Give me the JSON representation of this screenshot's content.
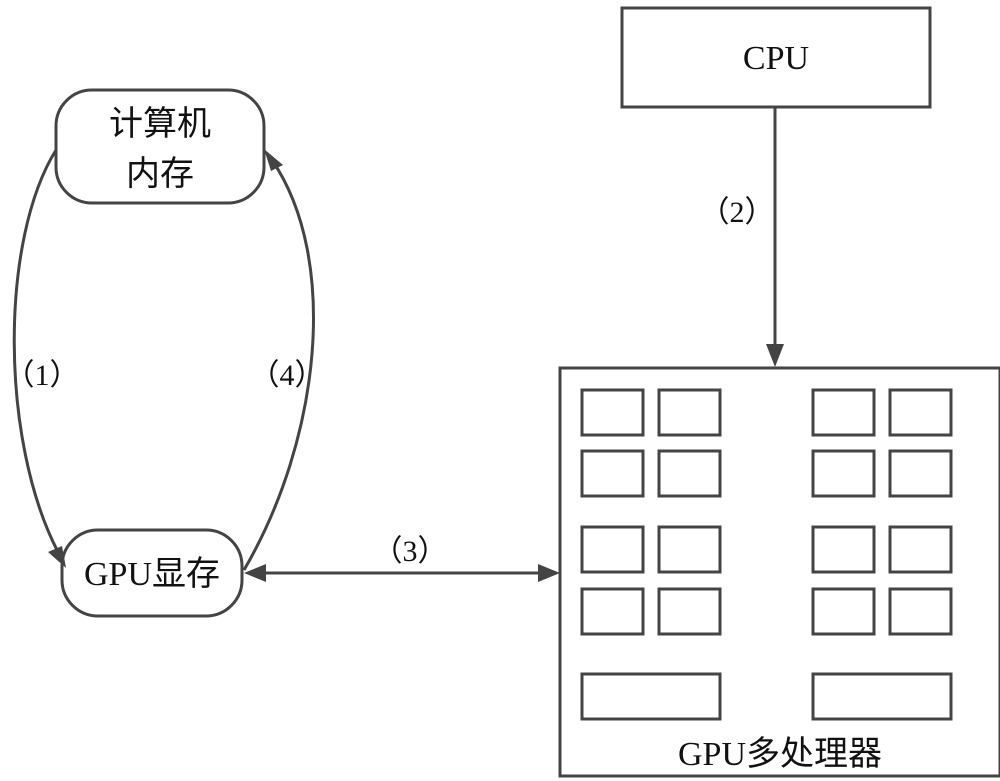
{
  "nodes": {
    "computer_memory": {
      "line1": "计算机",
      "line2": "内存"
    },
    "gpu_memory": {
      "label": "GPU显存"
    },
    "cpu": {
      "label": "CPU"
    },
    "gpu_multiprocessor": {
      "label": "GPU多处理器",
      "core_count": 16,
      "wide_units": 2
    }
  },
  "edges": [
    {
      "id": "1",
      "label": "（1）",
      "from": "计算机内存",
      "to": "GPU显存"
    },
    {
      "id": "2",
      "label": "（2）",
      "from": "CPU",
      "to": "GPU多处理器"
    },
    {
      "id": "3",
      "label": "（3）",
      "from": "GPU显存",
      "to": "GPU多处理器",
      "bidirectional": true
    },
    {
      "id": "4",
      "label": "（4）",
      "from": "GPU显存",
      "to": "计算机内存"
    }
  ],
  "colors": {
    "stroke": "#444444",
    "text": "#111111",
    "background": "#ffffff"
  }
}
